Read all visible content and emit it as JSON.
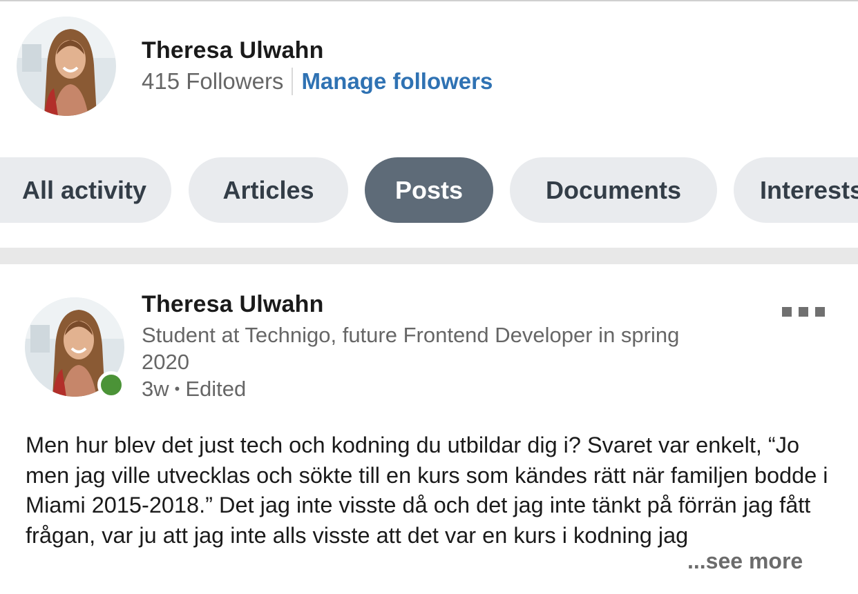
{
  "profile": {
    "name": "Theresa Ulwahn",
    "followers": "415 Followers",
    "manage_followers": "Manage followers"
  },
  "filters": {
    "items": [
      {
        "label": "All activity"
      },
      {
        "label": "Articles"
      },
      {
        "label": "Posts",
        "active": true
      },
      {
        "label": "Documents"
      },
      {
        "label": "Interests"
      }
    ]
  },
  "post": {
    "author": "Theresa Ulwahn",
    "headline": "Student at Technigo, future Frontend Developer in spring 2020",
    "age": "3w",
    "edited": "Edited",
    "separator": "•",
    "online": true,
    "text": "Men hur blev det just tech och kodning du utbildar dig i? Svaret var enkelt, “Jo men jag ville utvecklas och sökte till en kurs som kändes rätt när familjen bodde  i Miami 2015-2018.” Det jag inte visste då och det jag inte tänkt på förrän jag fått frågan, var ju att jag inte alls visste att det var en kurs i kodning jag",
    "see_more": "...see more"
  },
  "colors": {
    "link": "#2f72b3",
    "pill_bg": "#e9ebee",
    "pill_active_bg": "#5e6b78",
    "online": "#4b9337"
  },
  "icons": {
    "more": "more-horizontal-icon"
  }
}
